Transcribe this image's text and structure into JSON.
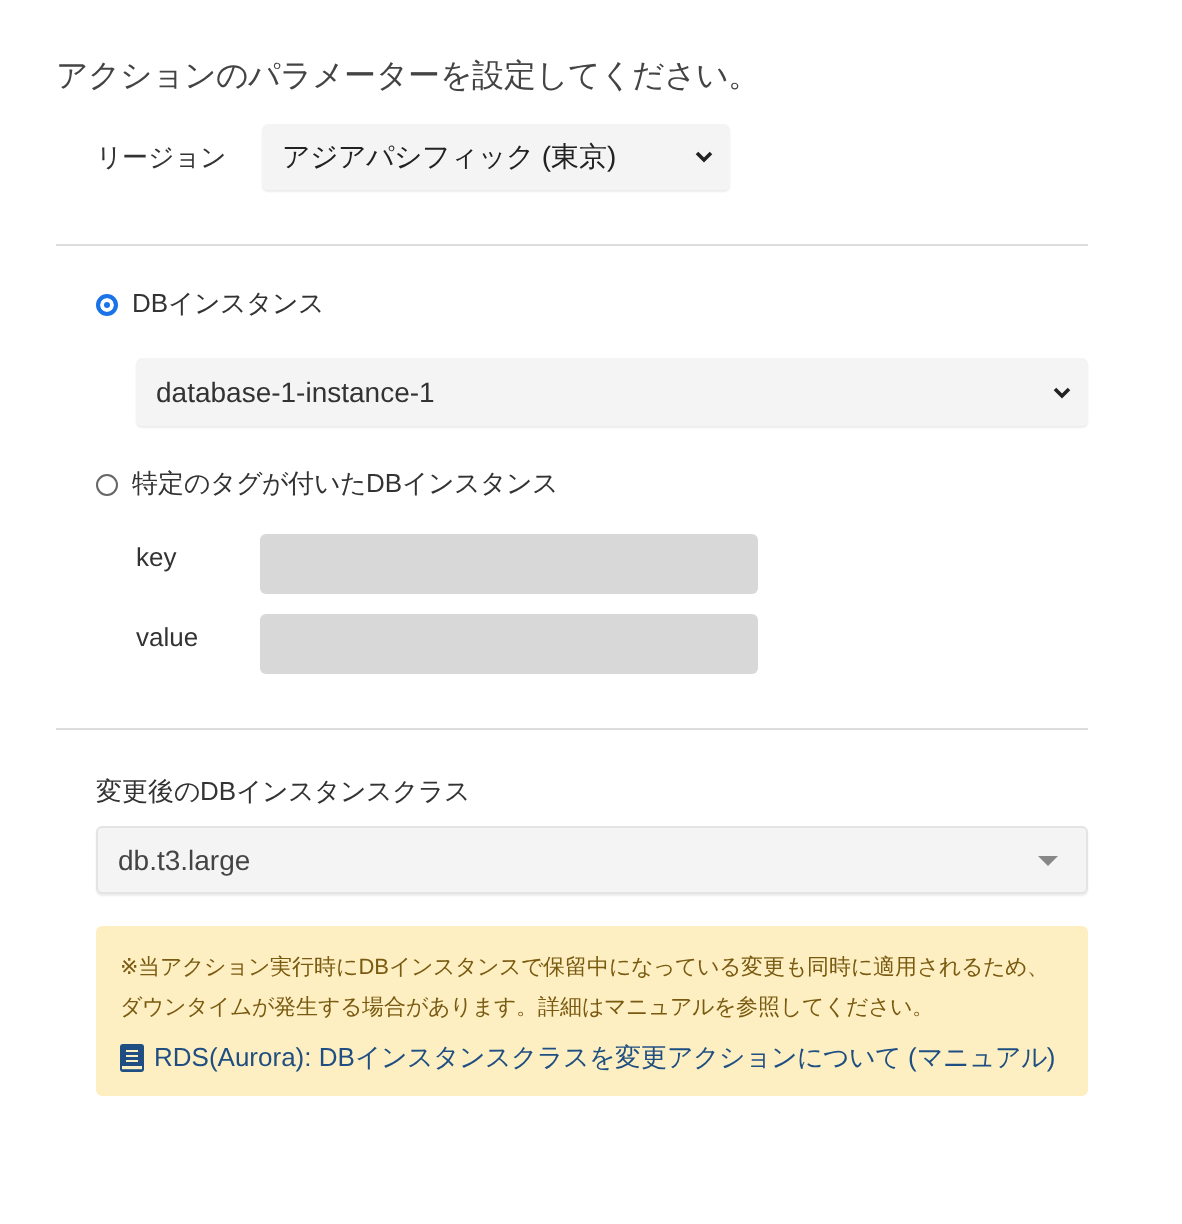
{
  "heading": "アクションのパラメーターを設定してください。",
  "region": {
    "label": "リージョン",
    "value": "アジアパシフィック (東京)"
  },
  "target_options": [
    {
      "kind": "instance",
      "label": "DBインスタンス",
      "selected": true,
      "select_value": "database-1-instance-1"
    },
    {
      "kind": "tags",
      "label": "特定のタグが付いたDBインスタンス",
      "selected": false,
      "fields": [
        {
          "label": "key"
        },
        {
          "label": "value"
        }
      ]
    }
  ],
  "instance_class": {
    "label": "変更後のDBインスタンスクラス",
    "value": "db.t3.large"
  },
  "notice": {
    "text": "※当アクション実行時にDBインスタンスで保留中になっている変更も同時に適用されるため、ダウンタイムが発生する場合があります。詳細はマニュアルを参照してください。",
    "link": "RDS(Aurora): DBインスタンスクラスを変更アクションについて (マニュアル)"
  }
}
